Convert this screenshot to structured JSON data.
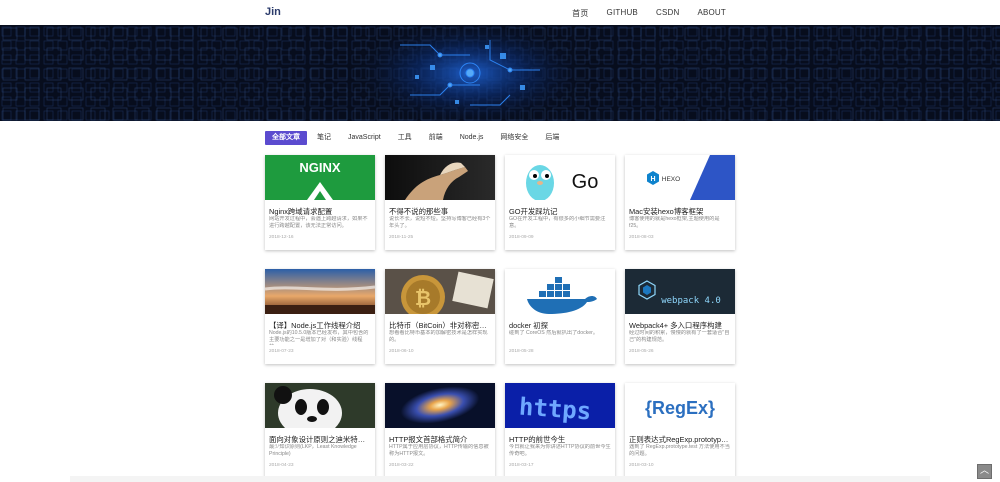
{
  "brand": "Jin",
  "nav": [
    "首页",
    "GITHUB",
    "CSDN",
    "ABOUT"
  ],
  "tabs": [
    {
      "label": "全部文章",
      "active": true
    },
    {
      "label": "笔记",
      "active": false
    },
    {
      "label": "JavaScript",
      "active": false
    },
    {
      "label": "工具",
      "active": false
    },
    {
      "label": "前端",
      "active": false
    },
    {
      "label": "Node.js",
      "active": false
    },
    {
      "label": "网络安全",
      "active": false
    },
    {
      "label": "后端",
      "active": false
    }
  ],
  "posts": [
    {
      "title": "Nginx跨域请求配置",
      "desc": "网站开发过程中，会遇上跨越请求，如果不进行跨越配置，该无法正常访问。",
      "date": "2018-12-16",
      "thumb": "nginx",
      "thumb_text": "NGINX"
    },
    {
      "title": "不得不说的那些事",
      "desc": "说长不长，说短不短。坚持写博客已经有3个年头了。",
      "date": "2018-11-25",
      "thumb": "wolf"
    },
    {
      "title": "GO开发踩坑记",
      "desc": "GO在开发工程中，有很多的小细节需要注意。",
      "date": "2018-09-09",
      "thumb": "go",
      "thumb_text": "Go"
    },
    {
      "title": "Mac安装hexo博客框架",
      "desc": "博客使用的就是hexo框架,主题使用的是f25。",
      "date": "2018-08-03",
      "thumb": "hexo",
      "thumb_text": "HEXO",
      "thumb_letter": "H"
    },
    {
      "title": "【译】Node.js工作线程介绍",
      "desc": "Node.js的10.5.0版本已经发布，其中包含的主要功能之一是增加了对（和实验）线程的。",
      "date": "2018-07-23",
      "thumb": "sky"
    },
    {
      "title": "比特币（BitCoin）非对称密钥...",
      "desc": "想看看比特币基本的加解密技术是怎样实现的。",
      "date": "2018-06-10",
      "thumb": "bitcoin"
    },
    {
      "title": "docker 初探",
      "desc": "碰到了 CoreOS 然后就扒出了docker。",
      "date": "2018-05-28",
      "thumb": "docker"
    },
    {
      "title": "Webpack4+ 多入口程序构建",
      "desc": "经过时间的积累，慢慢的就有了一套适合\"自己\"的构建规范。",
      "date": "2018-05-26",
      "thumb": "webpack",
      "thumb_text": "webpack 4.0"
    },
    {
      "title": "面向对象设计原则之迪米特原则",
      "desc": "最少知识原则(LKP，Least Knowledge Principle)",
      "date": "2018-04-23",
      "thumb": "panda"
    },
    {
      "title": "HTTP报文首部格式简介",
      "desc": "HTTP属于应用层协议，HTTP传输的信息被称为HTTP报文。",
      "date": "2018-03-22",
      "thumb": "galaxy"
    },
    {
      "title": "HTTP的前世今生",
      "desc": "今日就让我来为你讲述HTTP协议的前世今生传奇吧。",
      "date": "2018-03-17",
      "thumb": "https",
      "thumb_text": "https"
    },
    {
      "title": "正则表达式RegExp.prototype...",
      "desc": "遇到了 RegExp.prototype.test 方法使用不当的问题。",
      "date": "2018-03-10",
      "thumb": "regex",
      "thumb_text": "{RegEx}"
    }
  ],
  "back_to_top_icon": "chevron-up-icon"
}
